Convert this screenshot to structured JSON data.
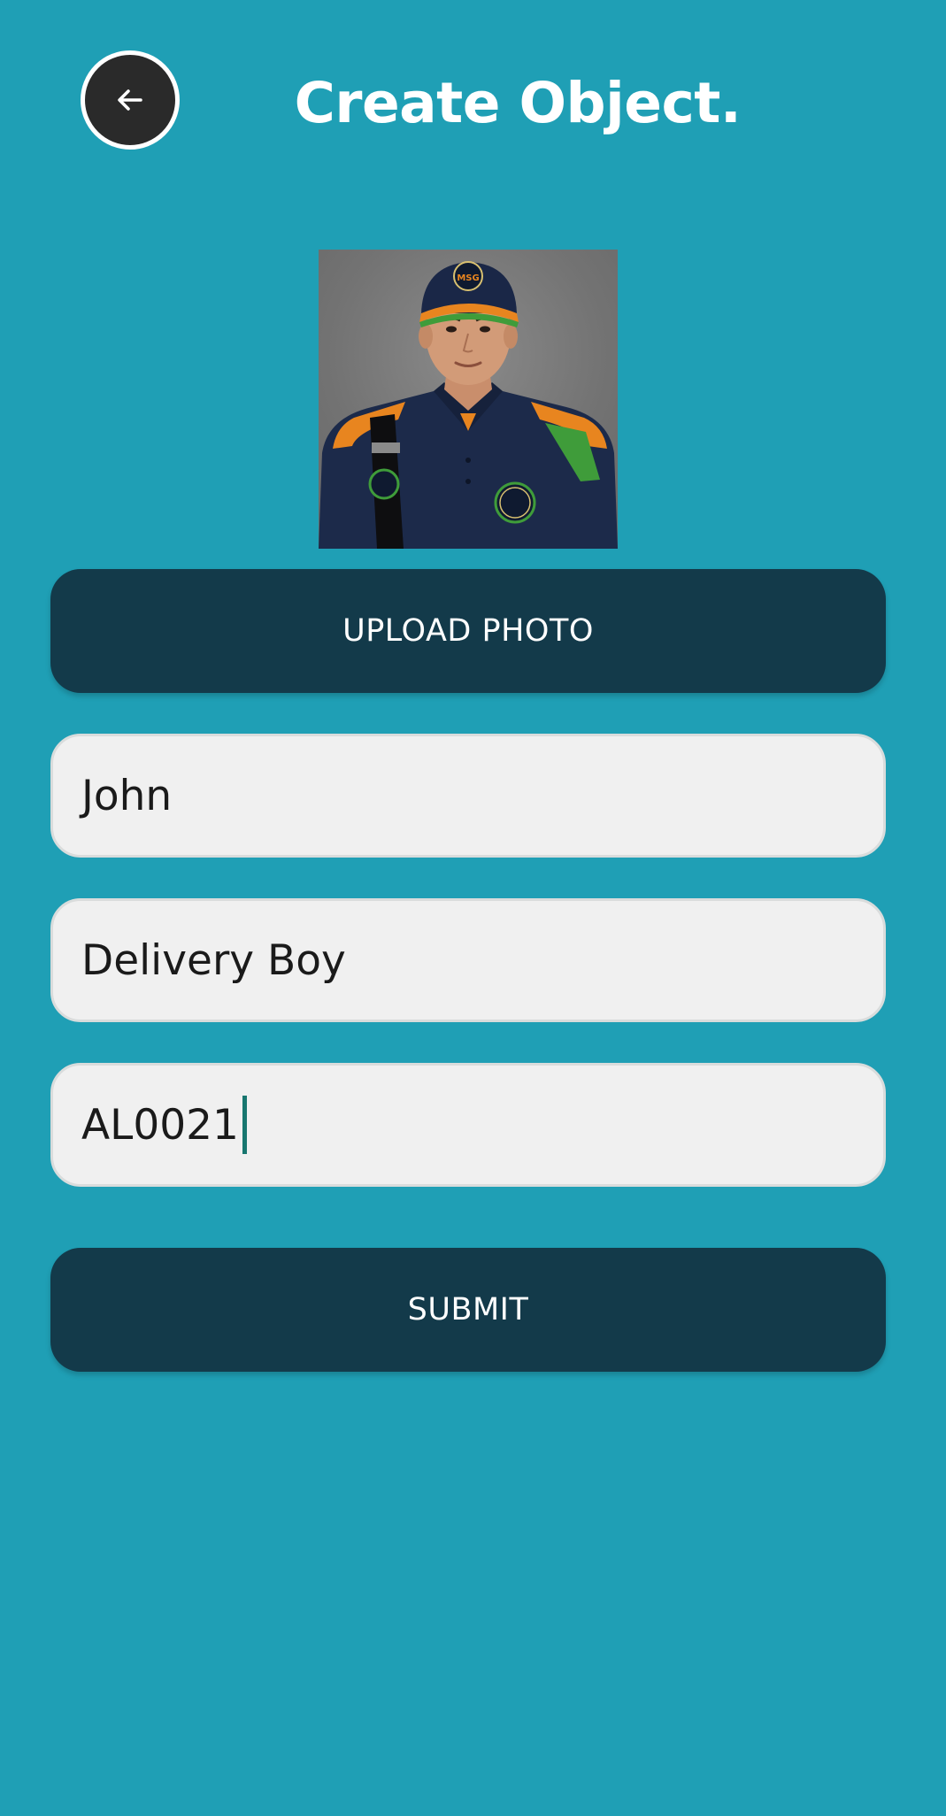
{
  "header": {
    "title": "Create Object.",
    "back_icon": "arrow-left-icon"
  },
  "photo": {
    "subject": "profile-photo",
    "badge_text": "MSG"
  },
  "upload_button": {
    "label": "UPLOAD PHOTO"
  },
  "form": {
    "name_field": {
      "value": "John"
    },
    "role_field": {
      "value": "Delivery Boy"
    },
    "id_field": {
      "value": "AL0021",
      "focused": true
    }
  },
  "submit_button": {
    "label": "SUBMIT"
  },
  "colors": {
    "background": "#1f9fb5",
    "button": "#133a4a",
    "field": "#f0f0f0",
    "caret": "#17766f"
  }
}
